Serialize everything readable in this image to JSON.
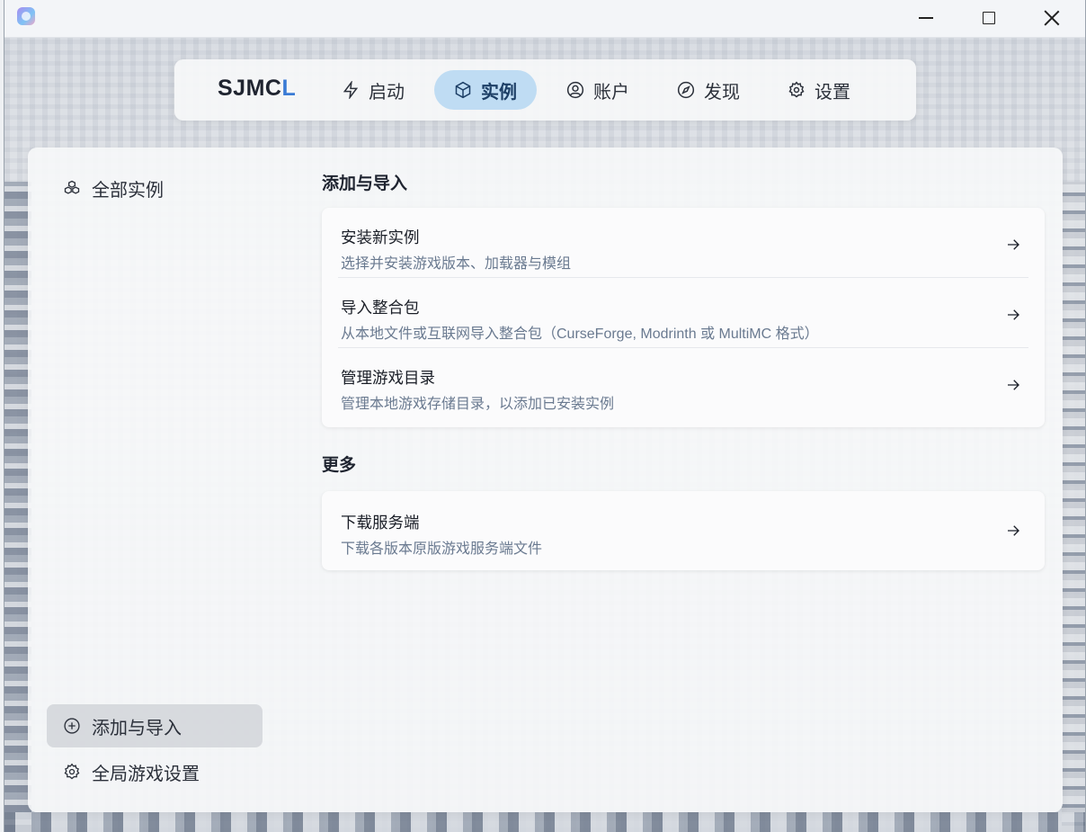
{
  "window": {
    "controls": {
      "minimize": "minimize-icon",
      "maximize": "maximize-icon",
      "close": "close-icon"
    }
  },
  "nav": {
    "brand_main": "SJMC",
    "brand_accent": "L",
    "items": [
      {
        "label": "启动",
        "icon": "zap-icon"
      },
      {
        "label": "实例",
        "icon": "cube-icon",
        "active": true
      },
      {
        "label": "账户",
        "icon": "user-circle-icon"
      },
      {
        "label": "发现",
        "icon": "compass-icon"
      },
      {
        "label": "设置",
        "icon": "gear-icon"
      }
    ]
  },
  "sidebar": {
    "all_instances": "全部实例",
    "add_import": "添加与导入",
    "global_settings": "全局游戏设置"
  },
  "main": {
    "section1_title": "添加与导入",
    "section1_items": [
      {
        "title": "安装新实例",
        "desc": "选择并安装游戏版本、加载器与模组"
      },
      {
        "title": "导入整合包",
        "desc": "从本地文件或互联网导入整合包（CurseForge, Modrinth 或 MultiMC 格式）"
      },
      {
        "title": "管理游戏目录",
        "desc": "管理本地游戏存储目录，以添加已安装实例"
      }
    ],
    "section2_title": "更多",
    "section2_items": [
      {
        "title": "下载服务端",
        "desc": "下载各版本原版游戏服务端文件"
      }
    ]
  },
  "colors": {
    "accent": "#3a7bd5",
    "active_tab_bg": "#bfdcf3",
    "desc_text": "#6a7a90"
  }
}
